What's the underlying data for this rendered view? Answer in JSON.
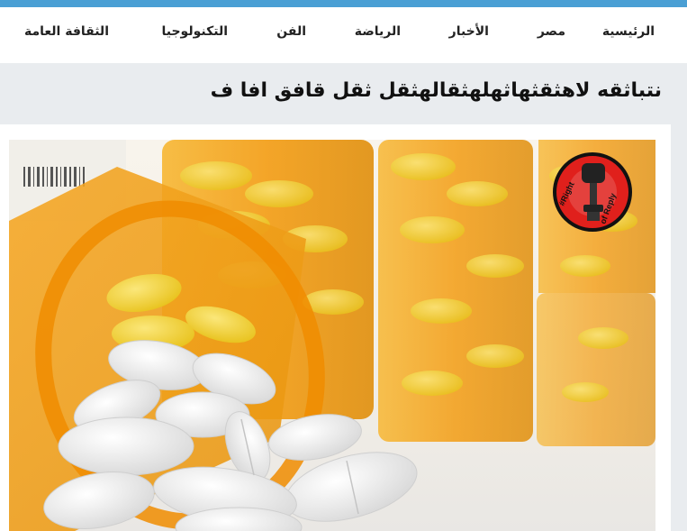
{
  "nav": {
    "items": [
      {
        "label": "الرئيسية"
      },
      {
        "label": "مصر"
      },
      {
        "label": "الأخبار"
      },
      {
        "label": "الرياضة"
      },
      {
        "label": "الفن"
      },
      {
        "label": "التكنولوجيا"
      },
      {
        "label": "الثقافة العامة"
      }
    ]
  },
  "article": {
    "title": "نتباثقه لاهثقثهاثهلهثقالهثقل ثقل قافق افا ف",
    "image_alt": "medicine pills spilling from orange pill bottles",
    "logo_text": "Right of Reply"
  },
  "colors": {
    "accent": "#4a9fd4",
    "page_bg": "#e9ecef",
    "bottle_orange": "#f39c12",
    "pill_yellow": "#f4d03f",
    "logo_red": "#e0201c"
  }
}
